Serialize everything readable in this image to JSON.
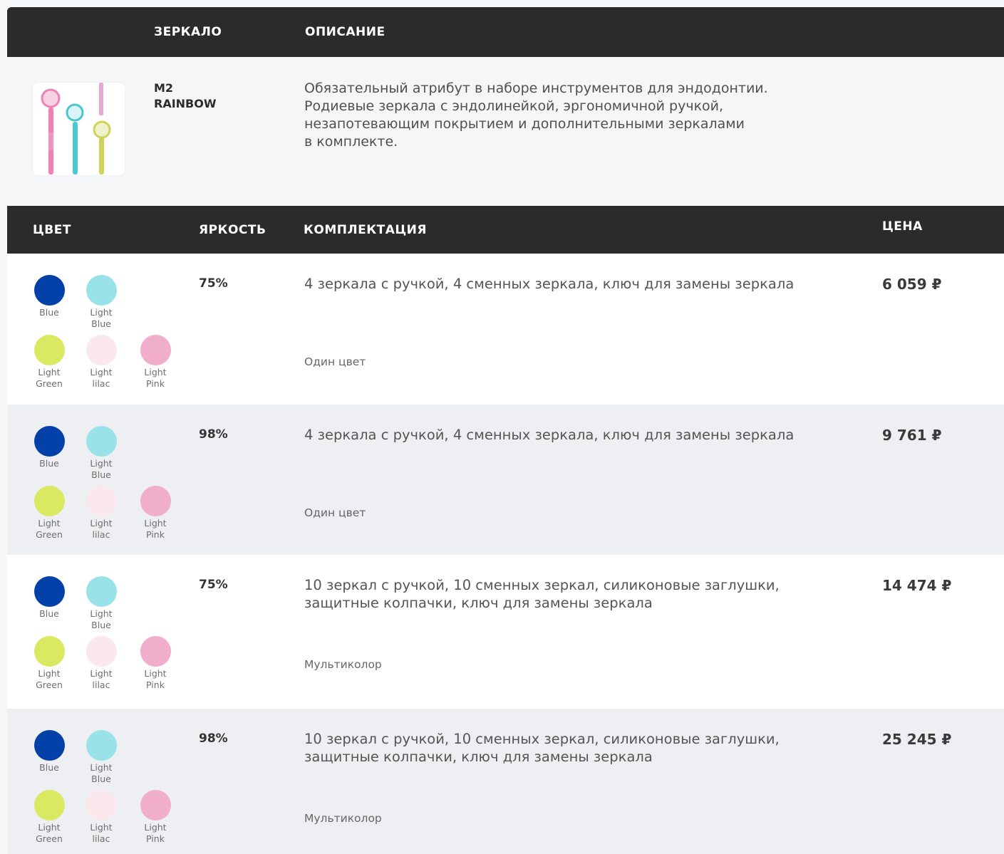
{
  "header": {
    "mirror": "ЗЕРКАЛО",
    "description": "ОПИСАНИЕ"
  },
  "product": {
    "model": "M2\nRAINBOW",
    "description": "Обязательный атрибут в наборе инструментов для эндодонтии.\nРодиевые зеркала с эндолинейкой, эргономичной ручкой,\nнезапотевающим покрытием и дополнительными зеркалами\nв комплекте."
  },
  "table_header": {
    "color": "ЦВЕТ",
    "brightness": "ЯРКОСТЬ",
    "kit": "КОМПЛЕКТАЦИЯ",
    "price": "ЦЕНА"
  },
  "swatches": [
    {
      "label": "Blue",
      "color": "#0340a8"
    },
    {
      "label": "Light\nBlue",
      "color": "#98e2e8"
    },
    {
      "label": "Light\nGreen",
      "color": "#d9ea62"
    },
    {
      "label": "Light\nlilac",
      "color": "#fbe8ec"
    },
    {
      "label": "Light\nPink",
      "color": "#f0aecb"
    }
  ],
  "variants": [
    {
      "brightness": "75%",
      "kit": "4 зеркала с ручкой, 4 сменных зеркала, ключ для замены зеркала",
      "kit_sub": "Один цвет",
      "price": "6 059 ₽"
    },
    {
      "brightness": "98%",
      "kit": "4 зеркала с ручкой, 4 сменных зеркала, ключ для замены зеркала",
      "kit_sub": "Один цвет",
      "price": "9 761 ₽"
    },
    {
      "brightness": "75%",
      "kit": "10 зеркал с ручкой, 10 сменных зеркал, силиконовые заглушки,\nзащитные колпачки, ключ для замены зеркала",
      "kit_sub": "Мультиколор",
      "price": "14 474 ₽"
    },
    {
      "brightness": "98%",
      "kit": "10 зеркал с ручкой, 10 сменных зеркал, силиконовые заглушки,\nзащитные колпачки, ключ для замены зеркала",
      "kit_sub": "Мультиколор",
      "price": "25 245 ₽"
    }
  ]
}
